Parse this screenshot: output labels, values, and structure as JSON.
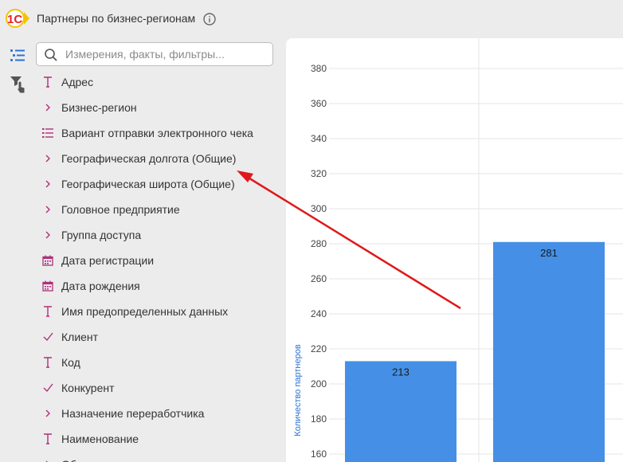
{
  "header": {
    "title": "Партнеры по бизнес-регионам",
    "logo_text": "1С"
  },
  "search": {
    "placeholder": "Измерения, факты, фильтры..."
  },
  "colors": {
    "accent_blue": "#4590e6",
    "icon_magenta": "#b0307a",
    "annotation_red": "#e0181b",
    "logo_red": "#e8202a",
    "logo_yellow": "#f5c400"
  },
  "fields": [
    {
      "label": "Адрес",
      "icon": "text-type-icon"
    },
    {
      "label": "Бизнес-регион",
      "icon": "chevron-right-icon"
    },
    {
      "label": "Вариант отправки электронного чека",
      "icon": "list-icon"
    },
    {
      "label": "Географическая долгота (Общие)",
      "icon": "chevron-right-icon"
    },
    {
      "label": "Географическая широта (Общие)",
      "icon": "chevron-right-icon"
    },
    {
      "label": "Головное предприятие",
      "icon": "chevron-right-icon"
    },
    {
      "label": "Группа доступа",
      "icon": "chevron-right-icon"
    },
    {
      "label": "Дата регистрации",
      "icon": "calendar-icon"
    },
    {
      "label": "Дата рождения",
      "icon": "calendar-icon"
    },
    {
      "label": "Имя предопределенных данных",
      "icon": "text-type-icon"
    },
    {
      "label": "Клиент",
      "icon": "check-icon"
    },
    {
      "label": "Код",
      "icon": "text-type-icon"
    },
    {
      "label": "Конкурент",
      "icon": "check-icon"
    },
    {
      "label": "Назначение переработчика",
      "icon": "chevron-right-icon"
    },
    {
      "label": "Наименование",
      "icon": "text-type-icon"
    },
    {
      "label": "Об",
      "icon": "chevron-right-icon"
    }
  ],
  "chart_data": {
    "type": "bar",
    "ylabel": "Количество партнеров",
    "ylim": [
      160,
      390
    ],
    "yticks": [
      160,
      180,
      200,
      220,
      240,
      260,
      280,
      300,
      320,
      340,
      360,
      380
    ],
    "values": [
      213,
      281
    ],
    "data_labels": [
      "213",
      "281"
    ],
    "color": "#4590e6",
    "grid": true
  }
}
